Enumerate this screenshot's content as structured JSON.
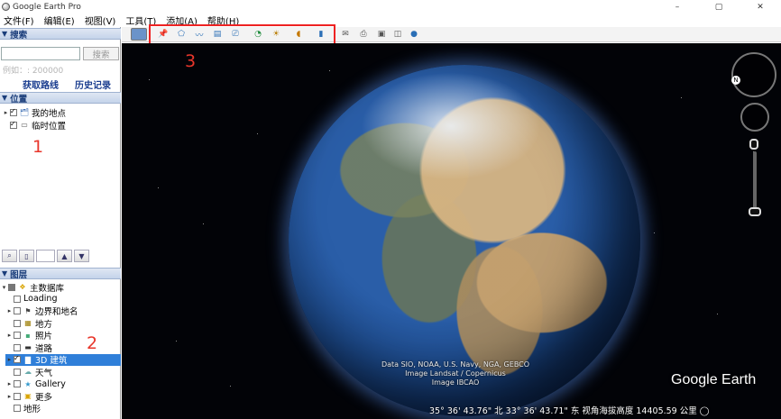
{
  "window": {
    "title": "Google Earth Pro",
    "min": "–",
    "restore": "▢",
    "close": "✕"
  },
  "menu": [
    "文件(F)",
    "编辑(E)",
    "视图(V)",
    "工具(T)",
    "添加(A)",
    "帮助(H)"
  ],
  "search": {
    "header": "搜索",
    "placeholder": "",
    "button": "搜索",
    "hint": "例如：: 200000",
    "directions": "获取路线",
    "history": "历史记录"
  },
  "places": {
    "header": "位置",
    "items": [
      {
        "label": "我的地点",
        "checked": true,
        "icon": "folder-globe-icon"
      },
      {
        "label": "临时位置",
        "checked": true,
        "icon": "folder-icon"
      }
    ]
  },
  "layers": {
    "header": "图层",
    "root": "主数据库",
    "items": [
      {
        "label": "Loading",
        "checked": false,
        "icon": "none",
        "expandable": false
      },
      {
        "label": "边界和地名",
        "checked": false,
        "icon": "borders-icon",
        "expandable": true
      },
      {
        "label": "地方",
        "checked": false,
        "icon": "places-icon",
        "expandable": false
      },
      {
        "label": "照片",
        "checked": false,
        "icon": "photo-icon",
        "expandable": true
      },
      {
        "label": "道路",
        "checked": false,
        "icon": "road-icon",
        "expandable": false
      },
      {
        "label": "3D 建筑",
        "checked": true,
        "icon": "building-icon",
        "expandable": true,
        "selected": true
      },
      {
        "label": "天气",
        "checked": false,
        "icon": "weather-icon",
        "expandable": false
      },
      {
        "label": "Gallery",
        "checked": false,
        "icon": "gallery-icon",
        "expandable": true
      },
      {
        "label": "更多",
        "checked": false,
        "icon": "more-icon",
        "expandable": true
      },
      {
        "label": "地形",
        "checked": false,
        "icon": "none",
        "expandable": false
      }
    ]
  },
  "annotations": {
    "a1": "1",
    "a2": "2",
    "a3": "3"
  },
  "toolbar": {
    "icons": [
      "sidebar-toggle-icon",
      "add-placemark-icon",
      "add-polygon-icon",
      "add-path-icon",
      "add-image-overlay-icon",
      "record-tour-icon",
      "historical-imagery-icon",
      "sunlight-icon",
      "planets-icon",
      "ruler-icon",
      "email-icon",
      "print-icon",
      "save-image-icon",
      "view-in-maps-icon",
      "earth-gallery-icon"
    ]
  },
  "view": {
    "credit_line1": "Data SIO, NOAA, U.S. Navy, NGA, GEBCO",
    "credit_line2": "Image Landsat / Copernicus",
    "credit_line3": "Image IBCAO",
    "brand": "Google Earth",
    "status": "35° 36' 43.76\" 北   33° 36' 43.71\" 东  视角海拔高度  14405.59 公里  ◯"
  },
  "colors": {
    "selection": "#2f7fd9",
    "annotation": "#e8362b",
    "header_text": "#1a3d7a"
  }
}
